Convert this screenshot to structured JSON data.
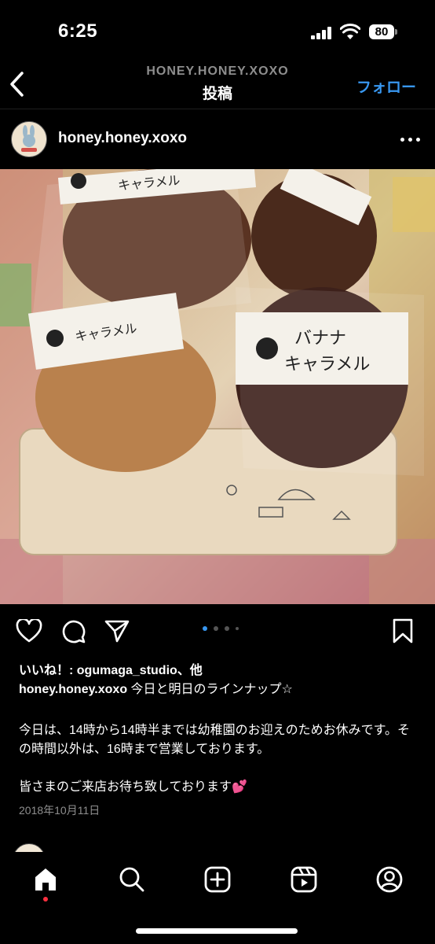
{
  "status_bar": {
    "time": "6:25",
    "battery": "80"
  },
  "header": {
    "account": "HONEY.HONEY.XOXO",
    "title": "投稿",
    "follow_label": "フォロー"
  },
  "post": {
    "username": "honey.honey.xoxo",
    "photo_labels": {
      "label_a": "バナナ",
      "label_b": "キャラメル",
      "label_top": "キャラメル"
    },
    "likes_text": "いいね！: ogumaga_studio、他",
    "caption_user": "honey.honey.xoxo",
    "caption_line1": " 今日と明日のラインナップ☆",
    "caption_p2": "今日は、14時から14時半までは幼稚園のお迎えのためお休みです。その時間以外は、16時まで営業しております。",
    "caption_p3": "皆さまのご来店お待ち致しております💕",
    "date": "2018年10月11日",
    "carousel": {
      "current": 1,
      "count": 4
    }
  },
  "tabbar": {
    "items": [
      "home",
      "search",
      "create",
      "reels",
      "profile"
    ],
    "active": "home"
  },
  "colors": {
    "accent": "#3897f0",
    "notification": "#ff3040"
  }
}
